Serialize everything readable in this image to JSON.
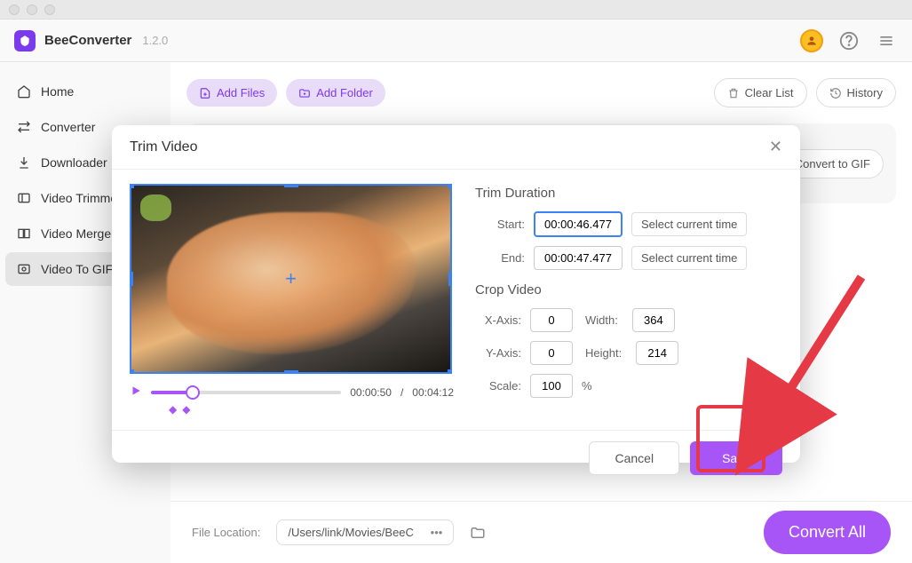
{
  "app": {
    "name": "BeeConverter",
    "version": "1.2.0"
  },
  "sidebar": {
    "items": [
      {
        "label": "Home"
      },
      {
        "label": "Converter"
      },
      {
        "label": "Downloader"
      },
      {
        "label": "Video Trimmer"
      },
      {
        "label": "Video Merger"
      },
      {
        "label": "Video To GIF"
      }
    ]
  },
  "toolbar": {
    "add_files": "Add Files",
    "add_folder": "Add Folder",
    "clear_list": "Clear List",
    "history": "History"
  },
  "filerow": {
    "convert_to_gif": "Convert to GIF"
  },
  "footer": {
    "file_loc_label": "File Location:",
    "file_loc_value": "/Users/link/Movies/BeeC",
    "file_loc_more": "•••",
    "convert_all": "Convert All"
  },
  "modal": {
    "title": "Trim Video",
    "trim_section": "Trim Duration",
    "start_label": "Start:",
    "start_value": "00:00:46.477",
    "end_label": "End:",
    "end_value": "00:00:47.477",
    "select_time": "Select current time",
    "crop_section": "Crop Video",
    "x_label": "X-Axis:",
    "x_value": "0",
    "width_label": "Width:",
    "width_value": "364",
    "y_label": "Y-Axis:",
    "y_value": "0",
    "height_label": "Height:",
    "height_value": "214",
    "scale_label": "Scale:",
    "scale_value": "100",
    "percent": "%",
    "current_time": "00:00:50",
    "total_time": "00:04:12",
    "time_sep": "/",
    "cancel": "Cancel",
    "save": "Save"
  }
}
